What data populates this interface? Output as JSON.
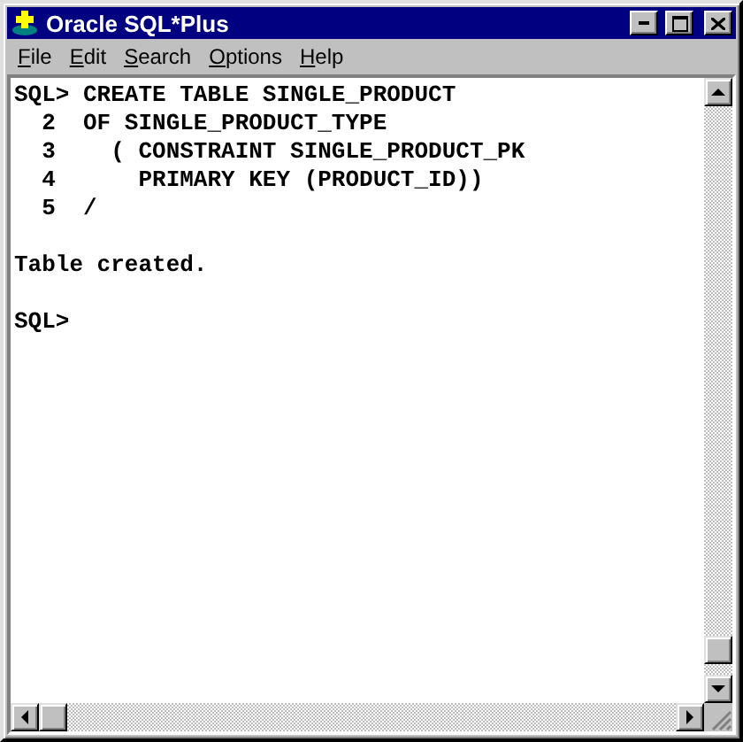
{
  "window": {
    "title": "Oracle SQL*Plus"
  },
  "menu": [
    "File",
    "Edit",
    "Search",
    "Options",
    "Help"
  ],
  "console": [
    {
      "lines": [
        "SQL> CREATE TABLE SINGLE_PRODUCT",
        "  2  OF SINGLE_PRODUCT_TYPE",
        "  3    ( CONSTRAINT SINGLE_PRODUCT_PK",
        "  4      PRIMARY KEY (PRODUCT_ID))",
        "  5  /"
      ]
    },
    {
      "lines": [
        "Table created."
      ]
    },
    {
      "lines": [
        "SQL>"
      ]
    }
  ]
}
